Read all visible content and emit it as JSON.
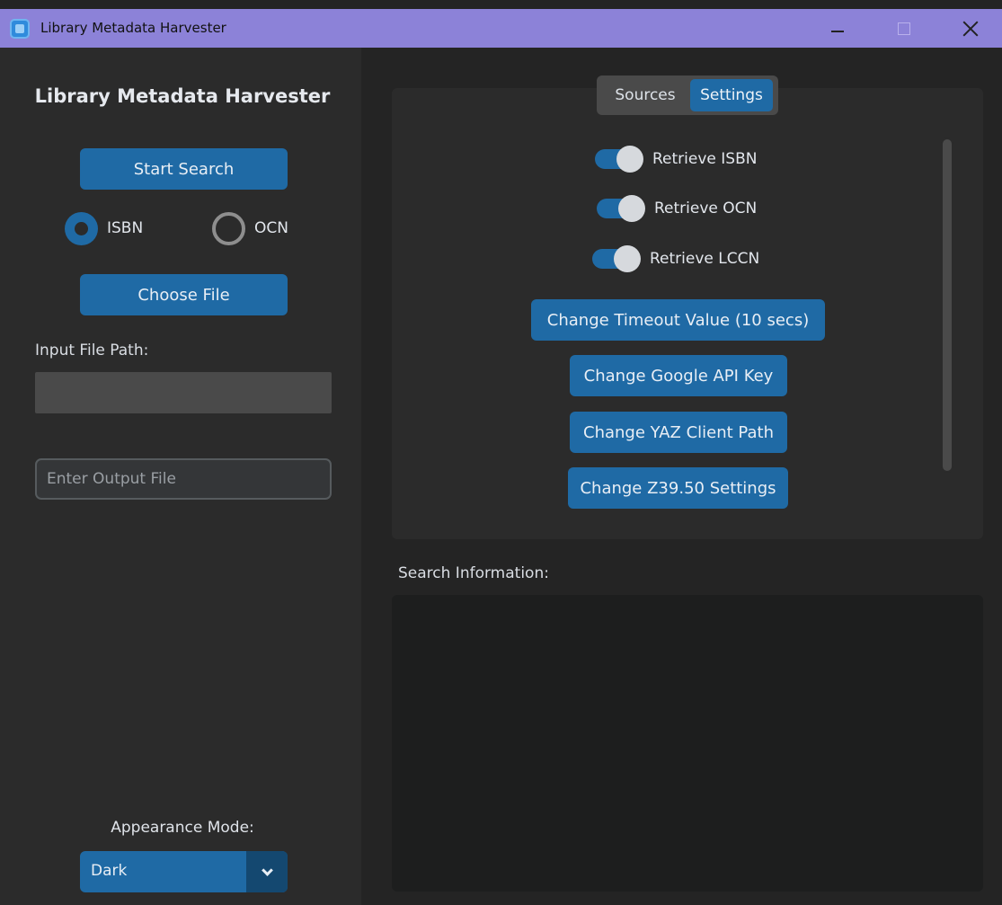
{
  "window": {
    "title": "Library Metadata Harvester"
  },
  "sidebar": {
    "title": "Library Metadata Harvester",
    "start_search_label": "Start Search",
    "search_type_options": [
      "ISBN",
      "OCN"
    ],
    "search_type_selected": "ISBN",
    "choose_file_label": "Choose File",
    "input_file_label": "Input File Path:",
    "input_file_value": "",
    "output_file_placeholder": "Enter Output File",
    "appearance_label": "Appearance Mode:",
    "appearance_value": "Dark"
  },
  "tabs": {
    "items": [
      "Sources",
      "Settings"
    ],
    "active": "Settings"
  },
  "settings": {
    "toggles": [
      {
        "label": "Retrieve ISBN",
        "on": true
      },
      {
        "label": "Retrieve OCN",
        "on": true
      },
      {
        "label": "Retrieve LCCN",
        "on": true
      }
    ],
    "timeout_button": "Change Timeout Value (10 secs)",
    "google_api_button": "Change Google API Key",
    "yaz_button": "Change YAZ Client Path",
    "z3950_button": "Change Z39.50 Settings"
  },
  "search_info": {
    "label": "Search Information:",
    "content": ""
  },
  "colors": {
    "accent": "#1f6aa5",
    "titlebar": "#8c82d8",
    "background": "#242424",
    "panel": "#2b2b2b"
  }
}
